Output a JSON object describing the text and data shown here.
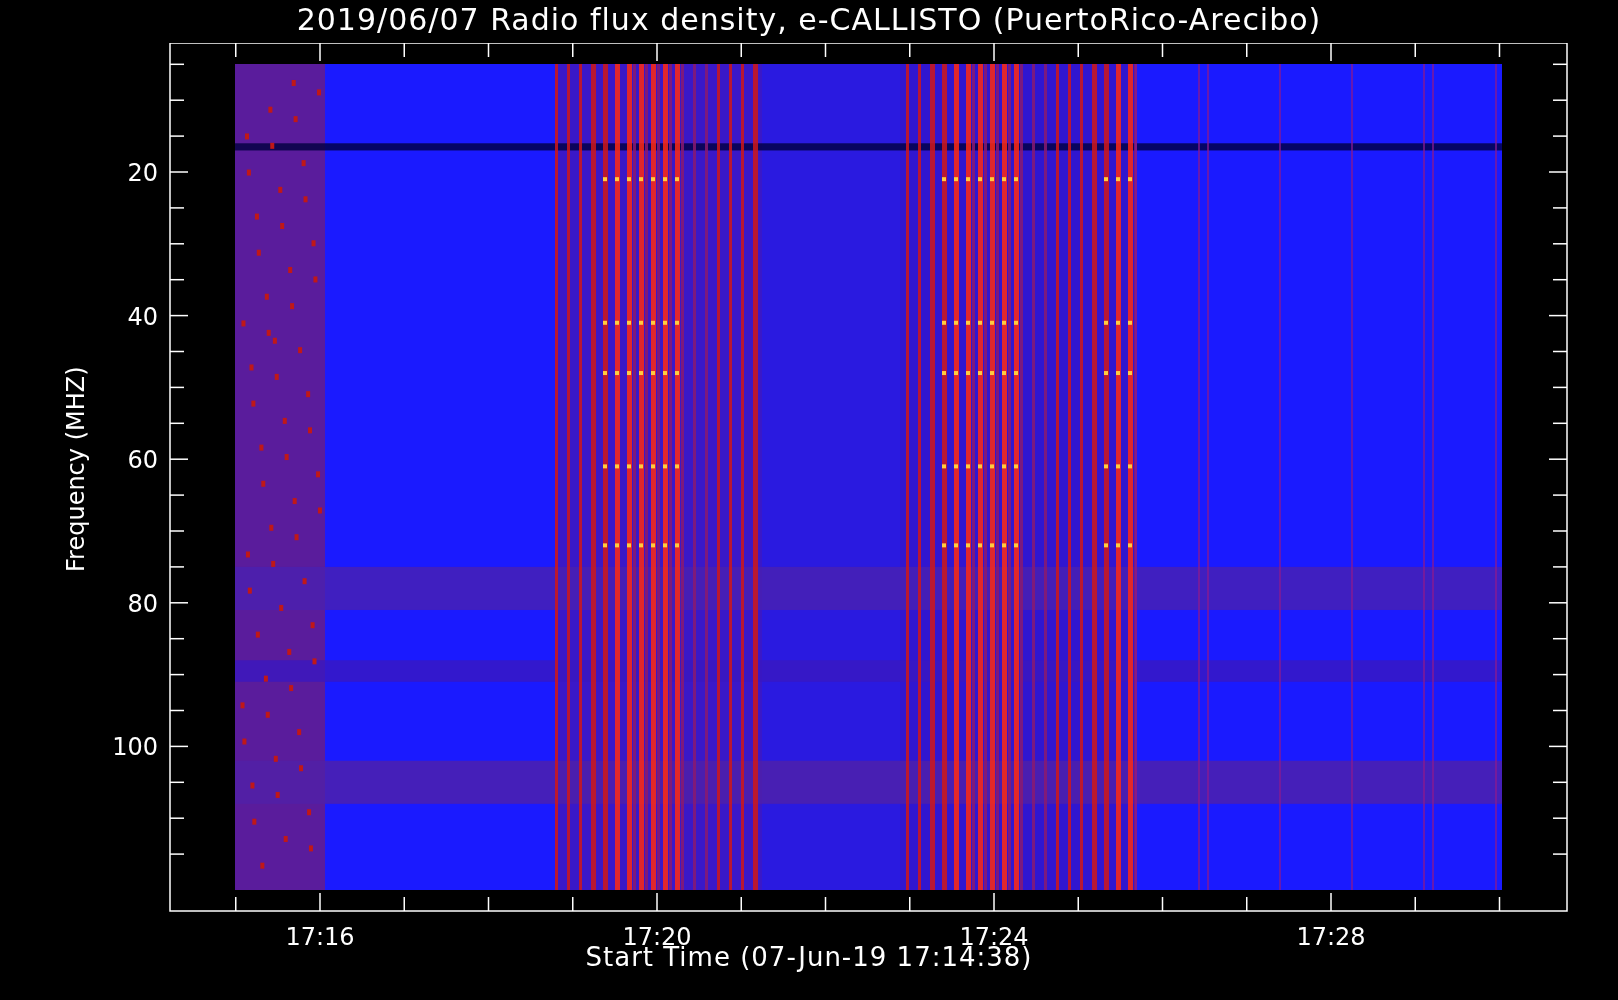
{
  "title": "2019/06/07  Radio flux density, e-CALLISTO (PuertoRico-Arecibo)",
  "y_axis": {
    "label": "Frequency (MHZ)",
    "ticks": [
      "20",
      "40",
      "60",
      "80",
      "100"
    ]
  },
  "x_axis": {
    "label": "Start Time (07-Jun-19 17:14:38)",
    "ticks": [
      "17:16",
      "17:20",
      "17:24",
      "17:28"
    ]
  }
}
